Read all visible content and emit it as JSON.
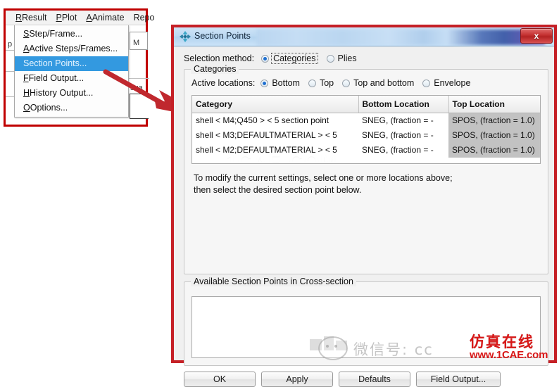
{
  "menu_screenshot": {
    "menubar": [
      {
        "label": "Result",
        "accel": "R"
      },
      {
        "label": "Plot",
        "accel": "P"
      },
      {
        "label": "Animate",
        "accel": "A"
      },
      {
        "label": "Repo",
        "accel": "p"
      }
    ],
    "popup_items": [
      {
        "label": "Step/Frame...",
        "selected": false
      },
      {
        "label": "Active Steps/Frames...",
        "selected": false
      },
      {
        "label": "Section Points...",
        "selected": true
      },
      {
        "label": "Field Output...",
        "selected": false
      },
      {
        "label": "History Output...",
        "selected": false
      },
      {
        "label": "Options...",
        "selected": false
      }
    ],
    "fragments": {
      "left_letter": "p",
      "right_letter": "M",
      "right_word": "sua"
    },
    "highlight_color": "#3399e0",
    "annotation_color": "#c00000"
  },
  "dialog": {
    "title": "Section Points",
    "title_icon": "section-points-icon",
    "close_label": "x",
    "selection_method": {
      "label": "Selection method:",
      "options": [
        {
          "label": "Categories",
          "checked": true,
          "focused": true
        },
        {
          "label": "Plies",
          "checked": false,
          "focused": false
        }
      ]
    },
    "categories_group": {
      "title": "Categories",
      "active_locations": {
        "label": "Active locations:",
        "options": [
          {
            "label": "Bottom",
            "checked": true
          },
          {
            "label": "Top",
            "checked": false
          },
          {
            "label": "Top and bottom",
            "checked": false
          },
          {
            "label": "Envelope",
            "checked": false
          }
        ]
      },
      "table": {
        "columns": [
          "Category",
          "Bottom Location",
          "Top Location"
        ],
        "rows": [
          {
            "category": "shell < M4;Q450 > < 5 section point",
            "bottom": "SNEG, (fraction = -",
            "top": "SPOS, (fraction = 1.0)",
            "top_selected": true
          },
          {
            "category": "shell < M3;DEFAULTMATERIAL > < 5",
            "bottom": "SNEG, (fraction = -",
            "top": "SPOS, (fraction = 1.0)",
            "top_selected": true
          },
          {
            "category": "shell < M2;DEFAULTMATERIAL > < 5",
            "bottom": "SNEG, (fraction = -",
            "top": "SPOS, (fraction = 1.0)",
            "top_selected": true
          }
        ],
        "watermark": "1CAE.COM"
      },
      "hint_line1": "To modify the current settings, select one or more locations above;",
      "hint_line2": "then select the desired section point below."
    },
    "available_group": {
      "title": "Available Section Points in Cross-section",
      "items": []
    },
    "buttons": [
      {
        "label": "OK",
        "name": "ok-button"
      },
      {
        "label": "Apply",
        "name": "apply-button"
      },
      {
        "label": "Defaults",
        "name": "defaults-button"
      },
      {
        "label": "Field Output...",
        "name": "field-output-button"
      }
    ],
    "border_color": "#c52026"
  },
  "watermarks": {
    "wechat_text": "微信号: cc",
    "logo_cn": "仿真在线",
    "logo_url": "www.1CAE.com",
    "logo_url_prefix": "www.",
    "logo_color": "#d81717"
  }
}
